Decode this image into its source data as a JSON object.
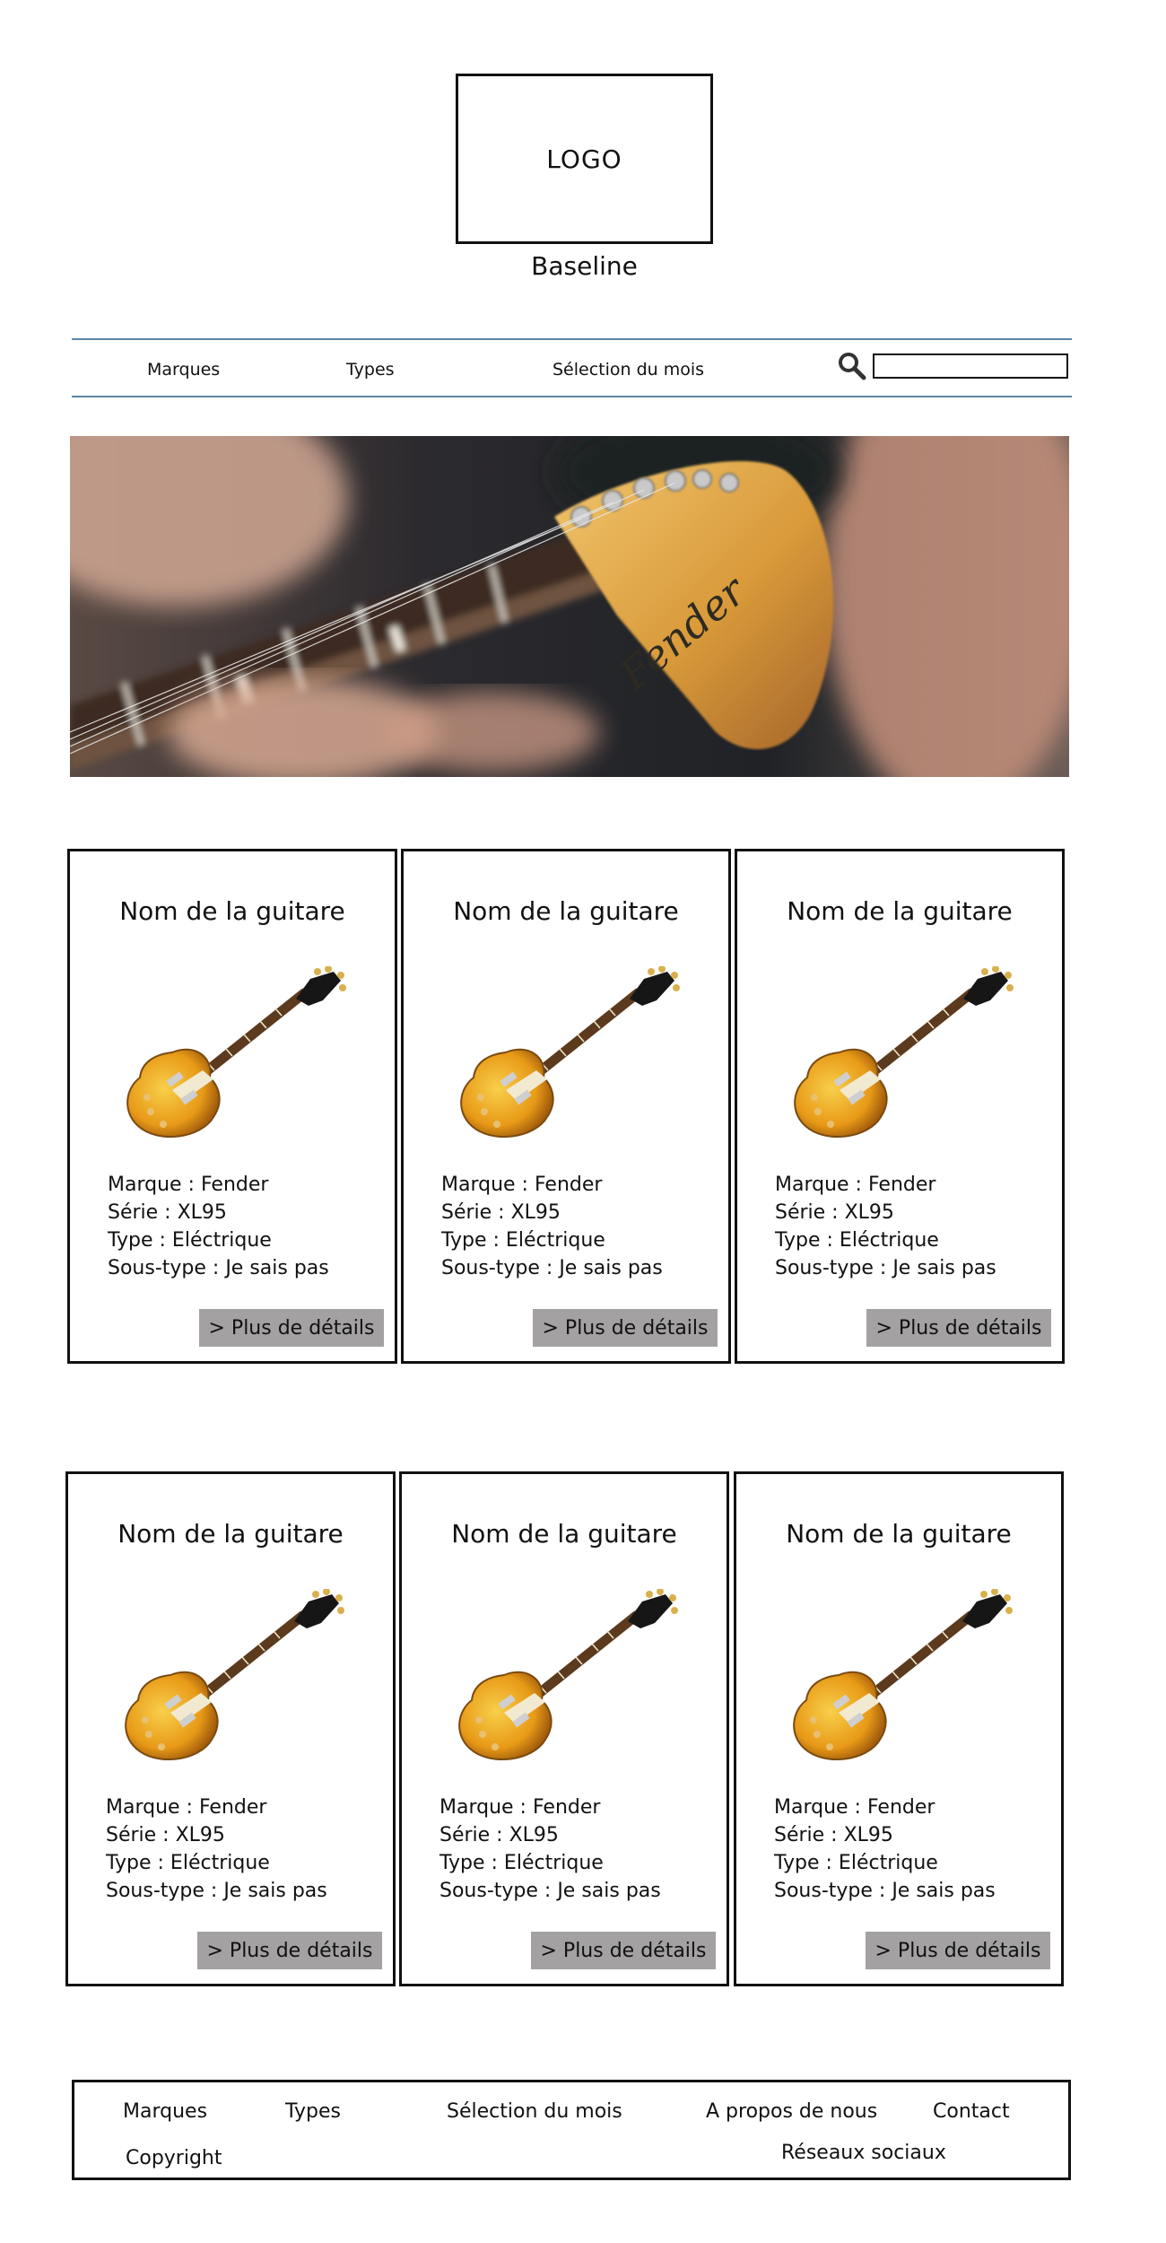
{
  "header": {
    "logo_text": "LOGO",
    "baseline": "Baseline"
  },
  "nav": {
    "items": [
      "Marques",
      "Types",
      "Sélection du mois"
    ],
    "search_value": ""
  },
  "products": [
    {
      "title": "Nom de la guitare",
      "brand": "Marque : Fender",
      "series": "Série : XL95",
      "type": "Type : Eléctrique",
      "subtype": "Sous-type : Je sais pas",
      "button": "> Plus de détails"
    },
    {
      "title": "Nom de la guitare",
      "brand": "Marque : Fender",
      "series": "Série : XL95",
      "type": "Type : Eléctrique",
      "subtype": "Sous-type : Je sais pas",
      "button": "> Plus de détails"
    },
    {
      "title": "Nom de la guitare",
      "brand": "Marque : Fender",
      "series": "Série : XL95",
      "type": "Type : Eléctrique",
      "subtype": "Sous-type : Je sais pas",
      "button": "> Plus de détails"
    },
    {
      "title": "Nom de la guitare",
      "brand": "Marque : Fender",
      "series": "Série : XL95",
      "type": "Type : Eléctrique",
      "subtype": "Sous-type : Je sais pas",
      "button": "> Plus de détails"
    },
    {
      "title": "Nom de la guitare",
      "brand": "Marque : Fender",
      "series": "Série : XL95",
      "type": "Type : Eléctrique",
      "subtype": "Sous-type : Je sais pas",
      "button": "> Plus de détails"
    },
    {
      "title": "Nom de la guitare",
      "brand": "Marque : Fender",
      "series": "Série : XL95",
      "type": "Type : Eléctrique",
      "subtype": "Sous-type : Je sais pas",
      "button": "> Plus de détails"
    }
  ],
  "footer": {
    "marques": "Marques",
    "types": "Types",
    "selection": "Sélection du mois",
    "about": "A propos de nous",
    "contact": "Contact",
    "copyright": "Copyright",
    "social": "Réseaux sociaux"
  },
  "colors": {
    "nav_border": "#5b87a6",
    "button_bg": "#a3a1a1"
  }
}
